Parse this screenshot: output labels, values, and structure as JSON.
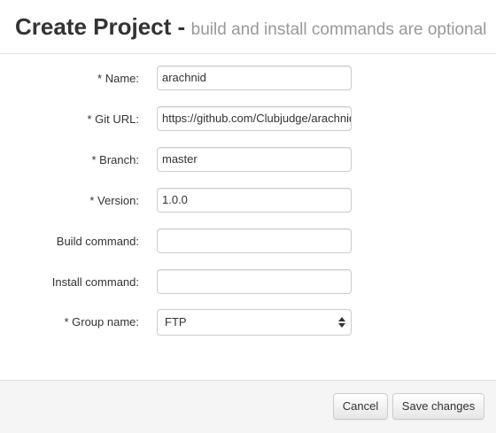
{
  "header": {
    "title": "Create Project -",
    "subtitle": "build and install commands are optional"
  },
  "form": {
    "name": {
      "label": "* Name:",
      "value": "arachnid"
    },
    "git_url": {
      "label": "* Git URL:",
      "value": "https://github.com/Clubjudge/arachnid"
    },
    "branch": {
      "label": "* Branch:",
      "value": "master"
    },
    "version": {
      "label": "* Version:",
      "value": "1.0.0"
    },
    "build_command": {
      "label": "Build command:",
      "value": ""
    },
    "install_command": {
      "label": "Install command:",
      "value": ""
    },
    "group_name": {
      "label": "* Group name:",
      "value": "FTP"
    }
  },
  "footer": {
    "cancel_label": "Cancel",
    "save_label": "Save changes"
  }
}
